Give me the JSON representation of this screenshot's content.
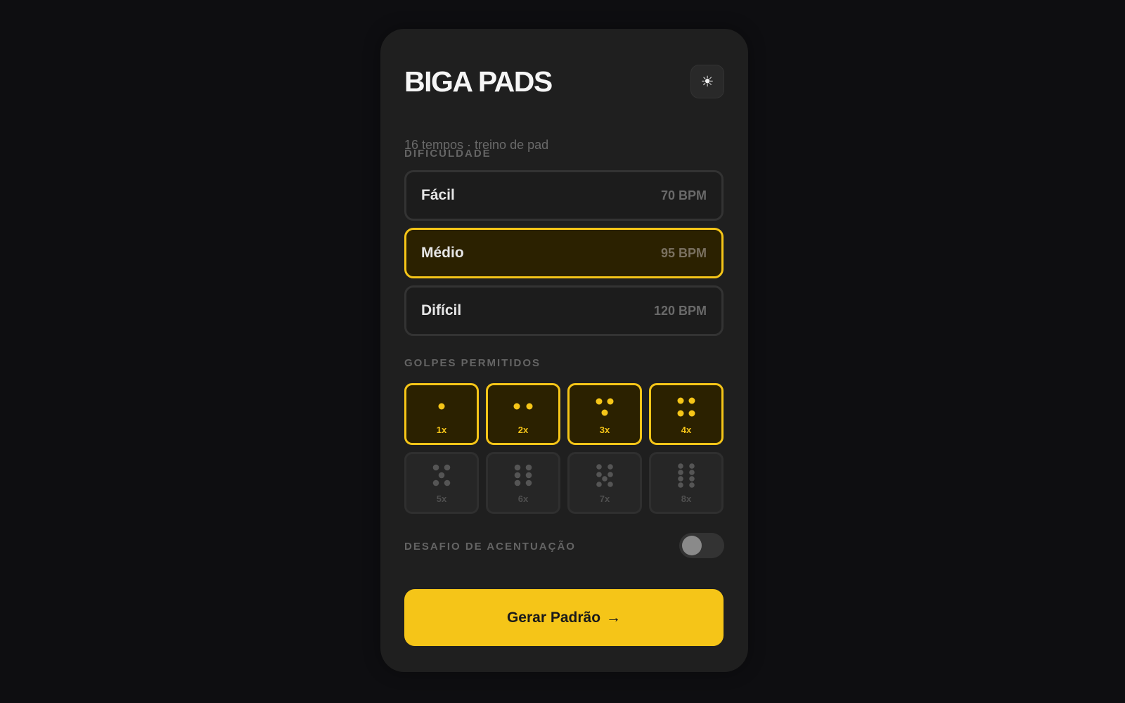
{
  "app": {
    "title": "BIGA PADS",
    "subtitle": "16 tempos · treino de pad",
    "theme_icon": "☀"
  },
  "difficulty": {
    "label": "DIFICULDADE",
    "options": [
      {
        "name": "Fácil",
        "bpm": "70 BPM",
        "selected": false
      },
      {
        "name": "Médio",
        "bpm": "95 BPM",
        "selected": true
      },
      {
        "name": "Difícil",
        "bpm": "120 BPM",
        "selected": false
      }
    ]
  },
  "strokes": {
    "label": "GOLPES PERMITIDOS",
    "options": [
      {
        "label": "1x",
        "count": 1,
        "selected": true
      },
      {
        "label": "2x",
        "count": 2,
        "selected": true
      },
      {
        "label": "3x",
        "count": 3,
        "selected": true
      },
      {
        "label": "4x",
        "count": 4,
        "selected": true
      },
      {
        "label": "5x",
        "count": 5,
        "selected": false
      },
      {
        "label": "6x",
        "count": 6,
        "selected": false
      },
      {
        "label": "7x",
        "count": 7,
        "selected": false
      },
      {
        "label": "8x",
        "count": 8,
        "selected": false
      }
    ]
  },
  "accent": {
    "label": "DESAFIO DE ACENTUAÇÃO",
    "enabled": false
  },
  "generate_button": {
    "label": "Gerar Padrão",
    "arrow": "→"
  },
  "colors": {
    "accent": "#f5c518",
    "background": "#0e0e11",
    "card": "#1f1f1f"
  }
}
